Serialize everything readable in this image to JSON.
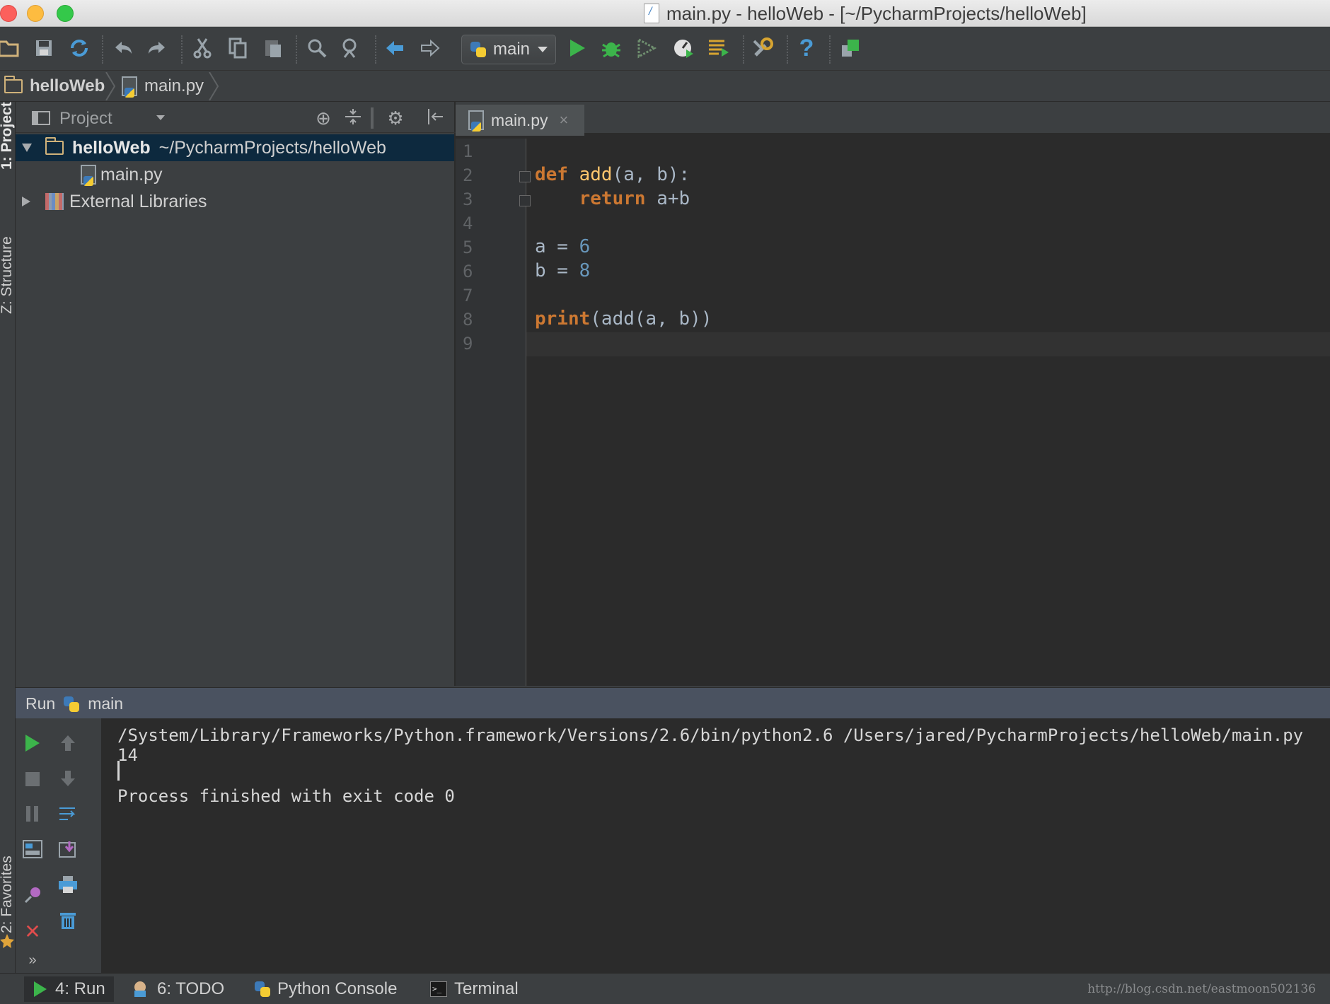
{
  "window": {
    "title": "main.py - helloWeb - [~/PycharmProjects/helloWeb]"
  },
  "toolbar": {
    "run_config": "main",
    "icons": [
      "open-folder-icon",
      "save-icon",
      "sync-icon",
      "undo-icon",
      "redo-icon",
      "cut-icon",
      "copy-icon",
      "paste-icon",
      "find-icon",
      "replace-icon",
      "back-icon",
      "forward-icon",
      "run-icon",
      "debug-icon",
      "coverage-icon",
      "profile-icon",
      "run-tasks-icon",
      "settings-icon",
      "help-icon",
      "vcs-icon"
    ]
  },
  "breadcrumb": {
    "project": "helloWeb",
    "file": "main.py"
  },
  "left_strip": {
    "tab_project": "1: Project",
    "tab_structure": "Z: Structure",
    "tab_favorites": "2: Favorites"
  },
  "project_panel": {
    "title": "Project",
    "root_name": "helloWeb",
    "root_path": "~/PycharmProjects/helloWeb",
    "file_name": "main.py",
    "external_libs": "External Libraries"
  },
  "editor": {
    "tab_label": "main.py",
    "tab_close": "×",
    "line_numbers": [
      "1",
      "2",
      "3",
      "4",
      "5",
      "6",
      "7",
      "8",
      "9"
    ]
  },
  "run_panel": {
    "label": "Run",
    "config": "main",
    "console_lines": [
      "/System/Library/Frameworks/Python.framework/Versions/2.6/bin/python2.6 /Users/jared/PycharmProjects/helloWeb/main.py",
      "14",
      "Process finished with exit code 0"
    ]
  },
  "statusbar": {
    "run_tab": "4: Run",
    "todo_tab": "6: TODO",
    "console_tab": "Python Console",
    "terminal_tab": "Terminal",
    "watermark": "http://blog.csdn.net/eastmoon502136"
  },
  "colors": {
    "editor_bg": "#2b2b2b",
    "keyword": "#cc7832",
    "function": "#ffc66d",
    "number": "#6897bb",
    "selection": "#0d293e"
  }
}
